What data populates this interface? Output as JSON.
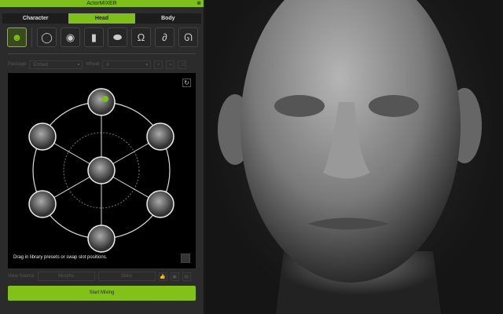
{
  "title": "ActorMIXER",
  "tabs": [
    "Character",
    "Head",
    "Body"
  ],
  "icons": [
    "head",
    "face-outline",
    "eye",
    "nose",
    "lips",
    "head-back",
    "ear",
    "hair"
  ],
  "package": {
    "label": "Package",
    "value": "Embed"
  },
  "wheel": {
    "label": "Wheel",
    "value": "6"
  },
  "canvas": {
    "hint": "Drag in library presets or swap slot positions."
  },
  "view_source": {
    "label": "View Source",
    "morphs": "Morphs",
    "skins": "Skins"
  },
  "start_label": "Start Mixing",
  "colors": {
    "accent": "#7fbf1a"
  }
}
